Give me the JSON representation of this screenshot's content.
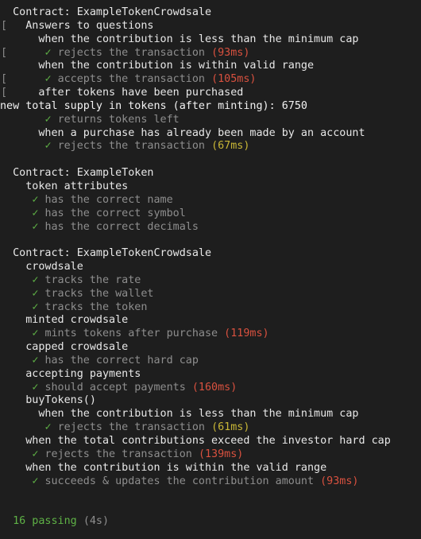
{
  "colors": {
    "background": "#1e1e1e",
    "text": "#e4e4e4",
    "pass_check": "#5fb246",
    "muted_test_title": "#8e8e8e",
    "slow_duration": "#d9513f",
    "medium_duration": "#c8b636"
  },
  "icons": {
    "check": "check-icon"
  },
  "lines": [
    {
      "type": "suite",
      "indent": 1,
      "text": "Contract: ExampleTokenCrowdsale"
    },
    {
      "type": "suite",
      "indent": 2,
      "text": "Answers to questions",
      "bracket": "["
    },
    {
      "type": "suite",
      "indent": 3,
      "text": "when the contribution is less than the minimum cap"
    },
    {
      "type": "test",
      "indent": 4,
      "text": "rejects the transaction",
      "duration": "(93ms)",
      "speed": "red",
      "bracket": "["
    },
    {
      "type": "suite",
      "indent": 3,
      "text": "when the contribution is within valid range"
    },
    {
      "type": "test",
      "indent": 4,
      "text": "accepts the transaction",
      "duration": "(105ms)",
      "speed": "red",
      "bracket": "["
    },
    {
      "type": "suite",
      "indent": 3,
      "text": "after tokens have been purchased",
      "bracket": "["
    },
    {
      "type": "log",
      "indent": 0,
      "text": "new total supply in tokens (after minting): 6750"
    },
    {
      "type": "test",
      "indent": 4,
      "text": "returns tokens left"
    },
    {
      "type": "suite",
      "indent": 3,
      "text": "when a purchase has already been made by an account"
    },
    {
      "type": "test",
      "indent": 4,
      "text": "rejects the transaction",
      "duration": "(67ms)",
      "speed": "yellow"
    },
    {
      "type": "blank"
    },
    {
      "type": "suite",
      "indent": 1,
      "text": "Contract: ExampleToken"
    },
    {
      "type": "suite",
      "indent": 2,
      "text": "token attributes"
    },
    {
      "type": "test",
      "indent": 3,
      "text": "has the correct name"
    },
    {
      "type": "test",
      "indent": 3,
      "text": "has the correct symbol"
    },
    {
      "type": "test",
      "indent": 3,
      "text": "has the correct decimals"
    },
    {
      "type": "blank"
    },
    {
      "type": "suite",
      "indent": 1,
      "text": "Contract: ExampleTokenCrowdsale"
    },
    {
      "type": "suite",
      "indent": 2,
      "text": "crowdsale"
    },
    {
      "type": "test",
      "indent": 3,
      "text": "tracks the rate"
    },
    {
      "type": "test",
      "indent": 3,
      "text": "tracks the wallet"
    },
    {
      "type": "test",
      "indent": 3,
      "text": "tracks the token"
    },
    {
      "type": "suite",
      "indent": 2,
      "text": "minted crowdsale"
    },
    {
      "type": "test",
      "indent": 3,
      "text": "mints tokens after purchase",
      "duration": "(119ms)",
      "speed": "red"
    },
    {
      "type": "suite",
      "indent": 2,
      "text": "capped crowdsale"
    },
    {
      "type": "test",
      "indent": 3,
      "text": "has the correct hard cap"
    },
    {
      "type": "suite",
      "indent": 2,
      "text": "accepting payments"
    },
    {
      "type": "test",
      "indent": 3,
      "text": "should accept payments",
      "duration": "(160ms)",
      "speed": "red"
    },
    {
      "type": "suite",
      "indent": 2,
      "text": "buyTokens()"
    },
    {
      "type": "suite",
      "indent": 3,
      "text": "when the contribution is less than the minimum cap"
    },
    {
      "type": "test",
      "indent": 4,
      "text": "rejects the transaction",
      "duration": "(61ms)",
      "speed": "yellow"
    },
    {
      "type": "suite",
      "indent": 2,
      "text": "when the total contributions exceed the investor hard cap"
    },
    {
      "type": "test",
      "indent": 3,
      "text": "rejects the transaction",
      "duration": "(139ms)",
      "speed": "red"
    },
    {
      "type": "suite",
      "indent": 2,
      "text": "when the contribution is within the valid range"
    },
    {
      "type": "test",
      "indent": 3,
      "text": "succeeds & updates the contribution amount",
      "duration": "(93ms)",
      "speed": "red"
    },
    {
      "type": "blank"
    },
    {
      "type": "blank"
    },
    {
      "type": "summary",
      "indent": 1,
      "count_text": "16 passing",
      "time_text": "(4s)"
    }
  ]
}
